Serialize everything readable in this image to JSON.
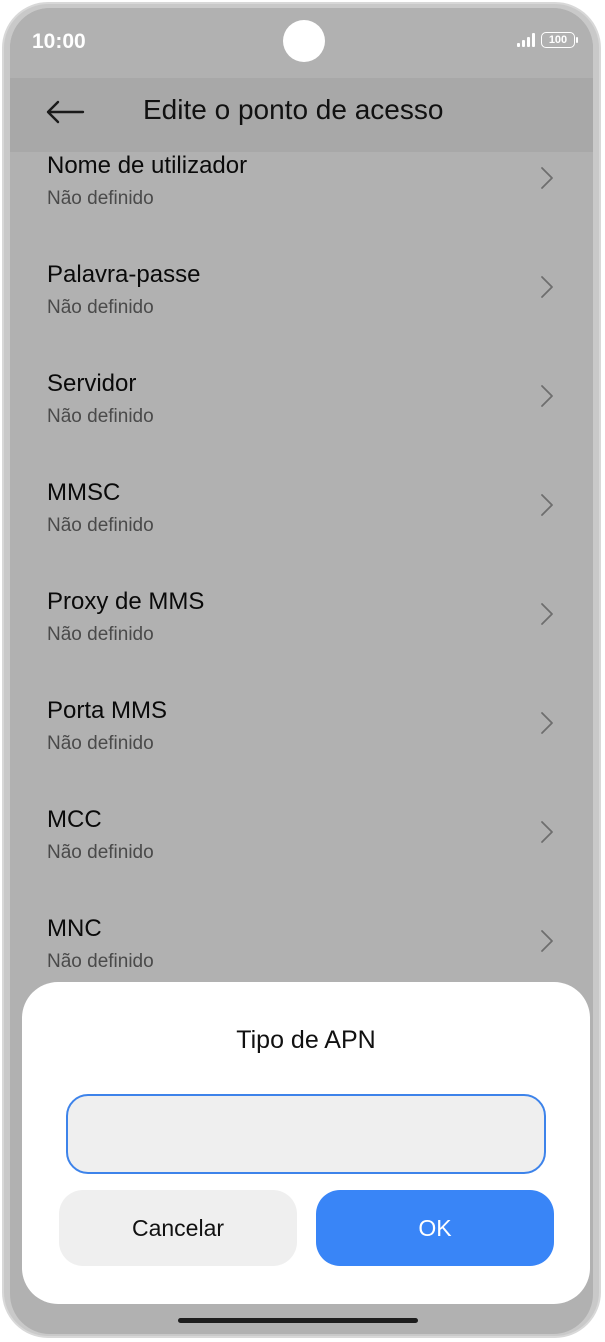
{
  "status_bar": {
    "time": "10:00",
    "battery": "100"
  },
  "header": {
    "title": "Edite o ponto de acesso"
  },
  "settings": {
    "items": [
      {
        "label": "Nome de utilizador",
        "value": "Não definido"
      },
      {
        "label": "Palavra-passe",
        "value": "Não definido"
      },
      {
        "label": "Servidor",
        "value": "Não definido"
      },
      {
        "label": "MMSC",
        "value": "Não definido"
      },
      {
        "label": "Proxy de MMS",
        "value": "Não definido"
      },
      {
        "label": "Porta MMS",
        "value": "Não definido"
      },
      {
        "label": "MCC",
        "value": "Não definido"
      },
      {
        "label": "MNC",
        "value": "Não definido"
      }
    ]
  },
  "dialog": {
    "title": "Tipo de APN",
    "input_value": "",
    "cancel_label": "Cancelar",
    "ok_label": "OK"
  },
  "colors": {
    "accent": "#3985f7",
    "input_border": "#3d83ea",
    "scrim": "#b1b1b1"
  }
}
